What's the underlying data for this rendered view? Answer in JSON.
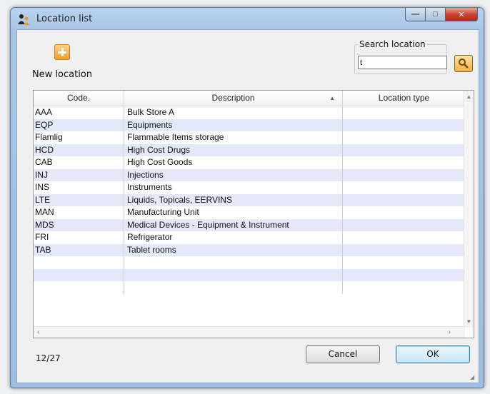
{
  "window": {
    "title": "Location list",
    "min_symbol": "—",
    "max_symbol": "□",
    "close_symbol": "✕"
  },
  "toolbar": {
    "new_location_label": "New location"
  },
  "search": {
    "label": "Search location",
    "value": "t"
  },
  "table": {
    "columns": [
      "Code.",
      "Description",
      "Location type"
    ],
    "sort_indicator": "▲",
    "rows": [
      {
        "code": "AAA",
        "description": "Bulk Store A",
        "type": ""
      },
      {
        "code": "EQP",
        "description": "Equipments",
        "type": ""
      },
      {
        "code": "Flamlig",
        "description": "Flammable Items storage",
        "type": ""
      },
      {
        "code": "HCD",
        "description": "High Cost Drugs",
        "type": ""
      },
      {
        "code": "CAB",
        "description": "High Cost Goods",
        "type": ""
      },
      {
        "code": "INJ",
        "description": "Injections",
        "type": ""
      },
      {
        "code": "INS",
        "description": "Instruments",
        "type": ""
      },
      {
        "code": "LTE",
        "description": "Liquids, Topicals, EERVINS",
        "type": ""
      },
      {
        "code": "MAN",
        "description": "Manufacturing Unit",
        "type": ""
      },
      {
        "code": "MDS",
        "description": "Medical Devices - Equipment & Instrument",
        "type": ""
      },
      {
        "code": "FRI",
        "description": "Refrigerator",
        "type": ""
      },
      {
        "code": "TAB",
        "description": "Tablet rooms",
        "type": ""
      }
    ],
    "empty_rows": 3
  },
  "footer": {
    "count": "12/27",
    "cancel_label": "Cancel",
    "ok_label": "OK"
  },
  "icons": {
    "app": "users-icon",
    "new": "add-icon",
    "search": "magnifier-icon"
  },
  "colors": {
    "row_alt": "#e3e9f9",
    "title_bar": "#a9c6e6",
    "close_button": "#c8412e"
  }
}
